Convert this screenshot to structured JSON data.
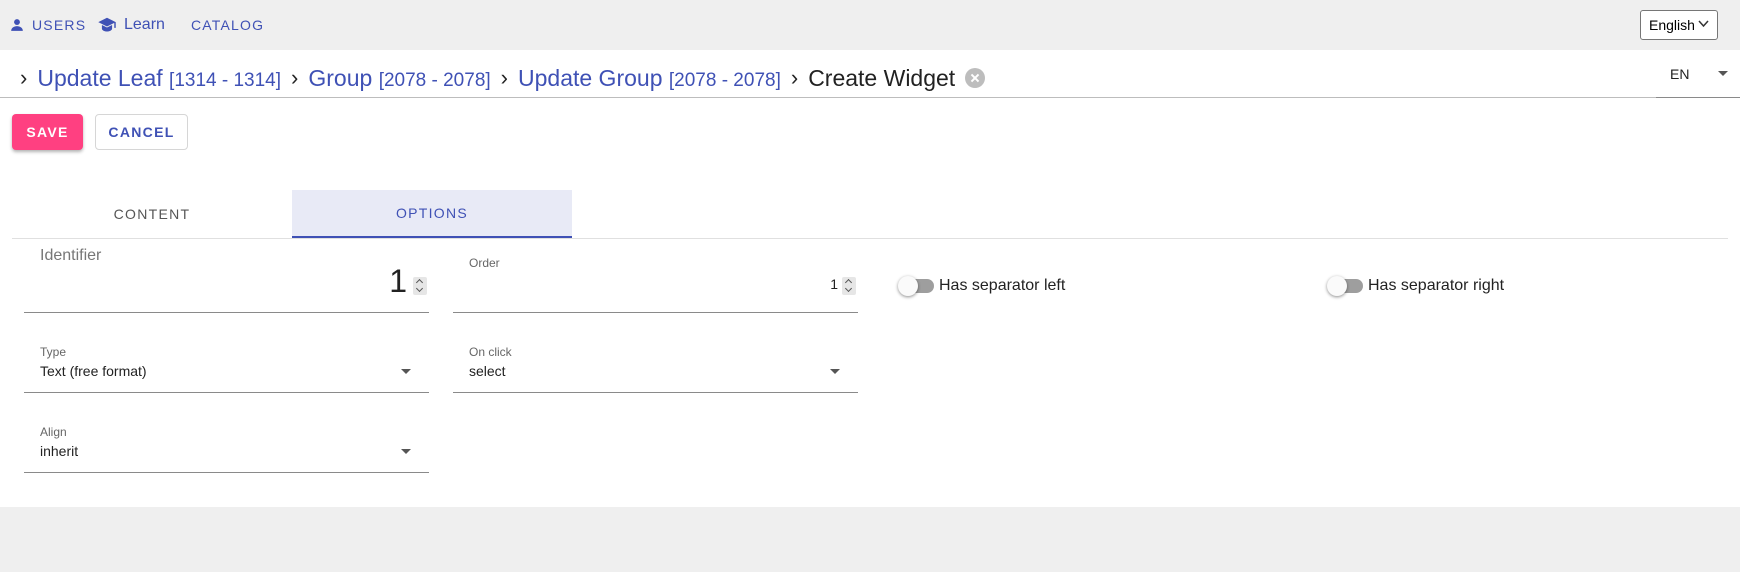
{
  "nav": {
    "users_label": "USERS",
    "learn_label": "Learn",
    "catalog_label": "CATALOG",
    "language": "English"
  },
  "breadcrumb": {
    "items": [
      {
        "label": "Update Leaf",
        "range": "[1314 - 1314]"
      },
      {
        "label": "Group",
        "range": "[2078 - 2078]"
      },
      {
        "label": "Update Group",
        "range": "[2078 - 2078]"
      }
    ],
    "current": "Create Widget",
    "separator": "›",
    "locale": "EN"
  },
  "toolbar": {
    "save_label": "SAVE",
    "cancel_label": "CANCEL"
  },
  "tabs": [
    {
      "label": "CONTENT",
      "active": false
    },
    {
      "label": "OPTIONS",
      "active": true
    }
  ],
  "form": {
    "identifier": {
      "label": "Identifier",
      "value": "1"
    },
    "order": {
      "label": "Order",
      "value": "1"
    },
    "has_separator_left": {
      "label": "Has separator left",
      "checked": false
    },
    "has_separator_right": {
      "label": "Has separator right",
      "checked": false
    },
    "type": {
      "label": "Type",
      "value": "Text (free format)"
    },
    "on_click": {
      "label": "On click",
      "value": "select"
    },
    "align": {
      "label": "Align",
      "value": "inherit"
    }
  },
  "colors": {
    "primary": "#3f51b5",
    "accent": "#ff4081",
    "active_tab_bg": "#e8eaf6"
  }
}
